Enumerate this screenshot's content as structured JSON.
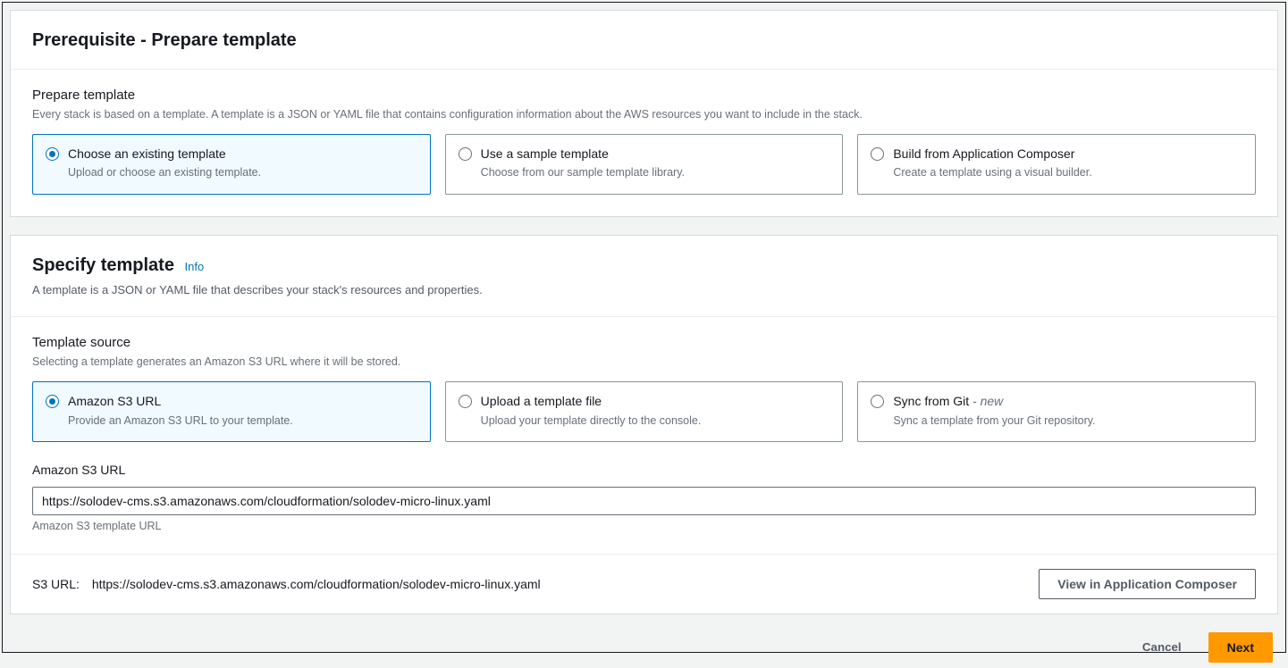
{
  "panel1": {
    "title": "Prerequisite - Prepare template",
    "section_label": "Prepare template",
    "section_desc": "Every stack is based on a template. A template is a JSON or YAML file that contains configuration information about the AWS resources you want to include in the stack.",
    "options": [
      {
        "title": "Choose an existing template",
        "desc": "Upload or choose an existing template."
      },
      {
        "title": "Use a sample template",
        "desc": "Choose from our sample template library."
      },
      {
        "title": "Build from Application Composer",
        "desc": "Create a template using a visual builder."
      }
    ]
  },
  "panel2": {
    "title": "Specify template",
    "info": "Info",
    "subtitle": "A template is a JSON or YAML file that describes your stack's resources and properties.",
    "source": {
      "label": "Template source",
      "desc": "Selecting a template generates an Amazon S3 URL where it will be stored.",
      "options": [
        {
          "title": "Amazon S3 URL",
          "desc": "Provide an Amazon S3 URL to your template."
        },
        {
          "title": "Upload a template file",
          "desc": "Upload your template directly to the console."
        },
        {
          "title": "Sync from Git",
          "new": " - new",
          "desc": "Sync a template from your Git repository."
        }
      ]
    },
    "url_field": {
      "label": "Amazon S3 URL",
      "value": "https://solodev-cms.s3.amazonaws.com/cloudformation/solodev-micro-linux.yaml",
      "hint": "Amazon S3 template URL"
    },
    "footer": {
      "s3_label": "S3 URL:",
      "s3_value": "https://solodev-cms.s3.amazonaws.com/cloudformation/solodev-micro-linux.yaml",
      "view_btn": "View in Application Composer"
    }
  },
  "actions": {
    "cancel": "Cancel",
    "next": "Next"
  }
}
